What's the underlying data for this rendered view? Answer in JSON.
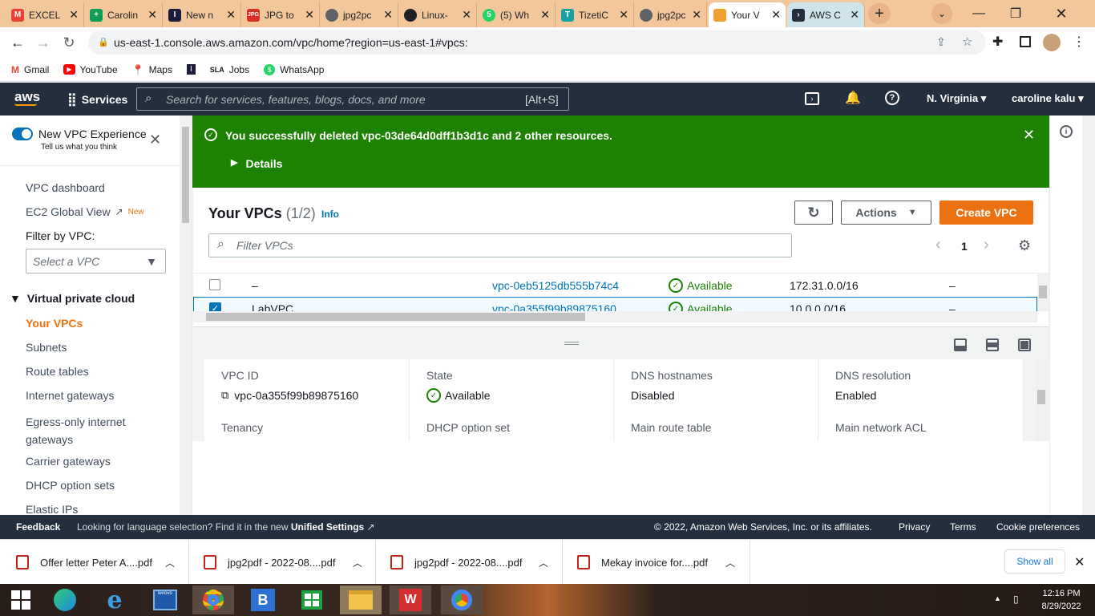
{
  "browser": {
    "tabs": [
      {
        "label": "EXCEL",
        "icon": "gmail-icon",
        "color": "#ea4335"
      },
      {
        "label": "Carolin",
        "icon": "sheets-icon",
        "color": "#0f9d58"
      },
      {
        "label": "New n",
        "icon": "indeed-icon",
        "color": "#1c1c3c"
      },
      {
        "label": "JPG to",
        "icon": "jpg2pdf-icon",
        "color": "#d93025"
      },
      {
        "label": "jpg2pc",
        "icon": "globe-icon",
        "color": "#5f6368"
      },
      {
        "label": "Linux-",
        "icon": "github-icon",
        "color": "#202124"
      },
      {
        "label": "(5) Wh",
        "icon": "whatsapp-icon",
        "color": "#25d366"
      },
      {
        "label": "TizetiC",
        "icon": "tizeti-icon",
        "color": "#1aa0a0"
      },
      {
        "label": "jpg2pc",
        "icon": "globe-icon",
        "color": "#5f6368"
      },
      {
        "label": "Your V",
        "icon": "aws-box-icon",
        "color": "#f0a030"
      },
      {
        "label": "AWS C",
        "icon": "terminal-icon",
        "color": "#232f3e"
      }
    ],
    "url": "us-east-1.console.aws.amazon.com/vpc/home?region=us-east-1#vpcs:",
    "bookmarks": [
      "Gmail",
      "YouTube",
      "Maps",
      "Jobs",
      "WhatsApp"
    ]
  },
  "awsnav": {
    "logo": "aws",
    "services": "Services",
    "search_placeholder": "Search for services, features, blogs, docs, and more",
    "search_shortcut": "[Alt+S]",
    "region": "N. Virginia",
    "account": "caroline kalu"
  },
  "sidebar": {
    "new_vpc_experience": "New VPC Experience",
    "tell_us": "Tell us what you think",
    "vpc_dashboard": "VPC dashboard",
    "ec2_global_view": "EC2 Global View",
    "new_badge": "New",
    "filter_label": "Filter by VPC:",
    "filter_placeholder": "Select a VPC",
    "section": "Virtual private cloud",
    "items": [
      "Your VPCs",
      "Subnets",
      "Route tables",
      "Internet gateways",
      "Egress-only internet gateways",
      "Carrier gateways",
      "DHCP option sets",
      "Elastic IPs"
    ]
  },
  "flash": {
    "message": "You successfully deleted vpc-03de64d0dff1b3d1c and 2 other resources.",
    "details": "Details"
  },
  "table": {
    "title": "Your VPCs",
    "count": "(1/2)",
    "info": "Info",
    "actions": "Actions",
    "create": "Create VPC",
    "filter_placeholder": "Filter VPCs",
    "page": "1",
    "rows": [
      {
        "name": "–",
        "vpc_id": "vpc-0eb5125db555b74c4",
        "state": "Available",
        "cidr": "172.31.0.0/16",
        "ipv6": "–",
        "checked": false
      },
      {
        "name": "LabVPC",
        "vpc_id": "vpc-0a355f99b89875160",
        "state": "Available",
        "cidr": "10.0.0.0/16",
        "ipv6": "–",
        "checked": true
      }
    ]
  },
  "details": {
    "labels": [
      "VPC ID",
      "State",
      "DNS hostnames",
      "DNS resolution"
    ],
    "vpc_id": "vpc-0a355f99b89875160",
    "state": "Available",
    "dns_hostnames": "Disabled",
    "dns_resolution": "Enabled",
    "labels2": [
      "Tenancy",
      "DHCP option set",
      "Main route table",
      "Main network ACL"
    ]
  },
  "footer": {
    "feedback": "Feedback",
    "lang_text": "Looking for language selection? Find it in the new",
    "unified": "Unified Settings",
    "copyright": "© 2022, Amazon Web Services, Inc. or its affiliates.",
    "privacy": "Privacy",
    "terms": "Terms",
    "cookies": "Cookie preferences"
  },
  "downloads": {
    "files": [
      "Offer letter Peter A....pdf",
      "jpg2pdf - 2022-08....pdf",
      "jpg2pdf - 2022-08....pdf",
      "Mekay invoice for....pdf"
    ],
    "show_all": "Show all"
  },
  "taskbar": {
    "time": "12:16 PM",
    "date": "8/29/2022"
  }
}
